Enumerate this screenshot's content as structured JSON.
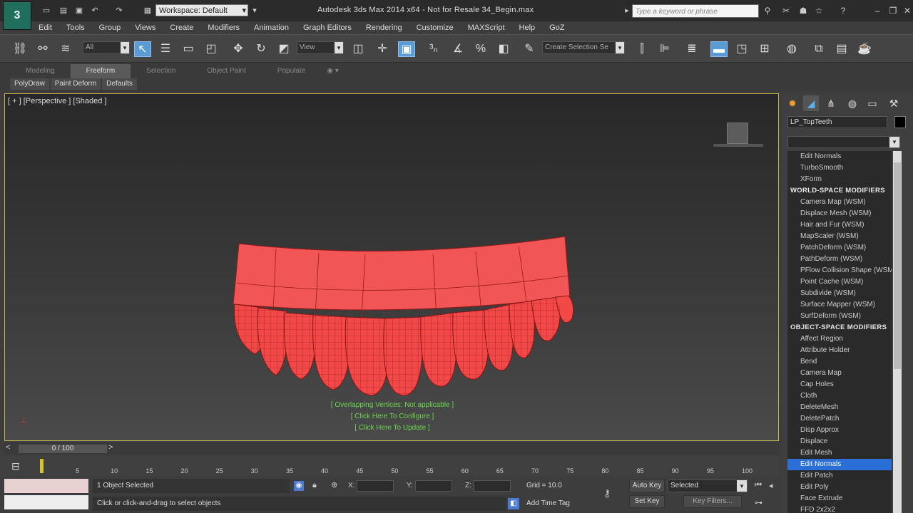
{
  "title_bar": {
    "workspace": "Workspace: Default",
    "title": "Autodesk 3ds Max  2014 x64  - Not for Resale   34_Begin.max",
    "search_placeholder": "Type a keyword or phrase"
  },
  "menu": [
    "Edit",
    "Tools",
    "Group",
    "Views",
    "Create",
    "Modifiers",
    "Animation",
    "Graph Editors",
    "Rendering",
    "Customize",
    "MAXScript",
    "Help",
    "GoZ"
  ],
  "toolbar": {
    "selection_filter": "All",
    "ref_coord": "View",
    "named_selection": "Create Selection Se"
  },
  "ribbon": {
    "tabs": [
      "Modeling",
      "Freeform",
      "Selection",
      "Object Paint",
      "Populate"
    ],
    "active_tab": "Freeform",
    "sub_buttons": [
      "PolyDraw",
      "Paint Deform",
      "Defaults"
    ]
  },
  "viewport": {
    "label": "[ + ] [Perspective ] [Shaded ]",
    "messages": [
      "[ Overlapping Vertices: Not applicable ]",
      "[ Click Here To Configure ]",
      "[ Click Here To Update ]"
    ]
  },
  "command_panel": {
    "object_name": "LP_TopTeeth",
    "modifier_list": [
      {
        "label": "Edit Normals",
        "type": "item"
      },
      {
        "label": "TurboSmooth",
        "type": "item"
      },
      {
        "label": "XForm",
        "type": "item"
      },
      {
        "label": "WORLD-SPACE MODIFIERS",
        "type": "header"
      },
      {
        "label": "Camera Map (WSM)",
        "type": "item"
      },
      {
        "label": "Displace Mesh (WSM)",
        "type": "item"
      },
      {
        "label": "Hair and Fur (WSM)",
        "type": "item"
      },
      {
        "label": "MapScaler (WSM)",
        "type": "item"
      },
      {
        "label": "PatchDeform (WSM)",
        "type": "item"
      },
      {
        "label": "PathDeform (WSM)",
        "type": "item"
      },
      {
        "label": "PFlow Collision Shape (WSM)",
        "type": "item"
      },
      {
        "label": "Point Cache (WSM)",
        "type": "item"
      },
      {
        "label": "Subdivide (WSM)",
        "type": "item"
      },
      {
        "label": "Surface Mapper (WSM)",
        "type": "item"
      },
      {
        "label": "SurfDeform (WSM)",
        "type": "item"
      },
      {
        "label": "OBJECT-SPACE MODIFIERS",
        "type": "header"
      },
      {
        "label": "Affect Region",
        "type": "item"
      },
      {
        "label": "Attribute Holder",
        "type": "item"
      },
      {
        "label": "Bend",
        "type": "item"
      },
      {
        "label": "Camera Map",
        "type": "item"
      },
      {
        "label": "Cap Holes",
        "type": "item"
      },
      {
        "label": "Cloth",
        "type": "item"
      },
      {
        "label": "DeleteMesh",
        "type": "item"
      },
      {
        "label": "DeletePatch",
        "type": "item"
      },
      {
        "label": "Disp Approx",
        "type": "item"
      },
      {
        "label": "Displace",
        "type": "item"
      },
      {
        "label": "Edit Mesh",
        "type": "item"
      },
      {
        "label": "Edit Normals",
        "type": "selected"
      },
      {
        "label": "Edit Patch",
        "type": "item"
      },
      {
        "label": "Edit Poly",
        "type": "item"
      },
      {
        "label": "Face Extrude",
        "type": "item"
      },
      {
        "label": "FFD 2x2x2",
        "type": "item"
      }
    ]
  },
  "timeline": {
    "frame": "0 / 100",
    "ticks": [
      "5",
      "10",
      "15",
      "20",
      "25",
      "30",
      "35",
      "40",
      "45",
      "50",
      "55",
      "60",
      "65",
      "70",
      "75",
      "80",
      "85",
      "90",
      "95",
      "100"
    ]
  },
  "status": {
    "selected": "1 Object Selected",
    "prompt": "Click or click-and-drag to select objects",
    "grid": "Grid = 10.0",
    "add_time_tag": "Add Time Tag",
    "auto_key": "Auto Key",
    "set_key": "Set Key",
    "key_mode": "Selected",
    "key_filters": "Key Filters...",
    "x_label": "X:",
    "y_label": "Y:",
    "z_label": "Z:"
  }
}
